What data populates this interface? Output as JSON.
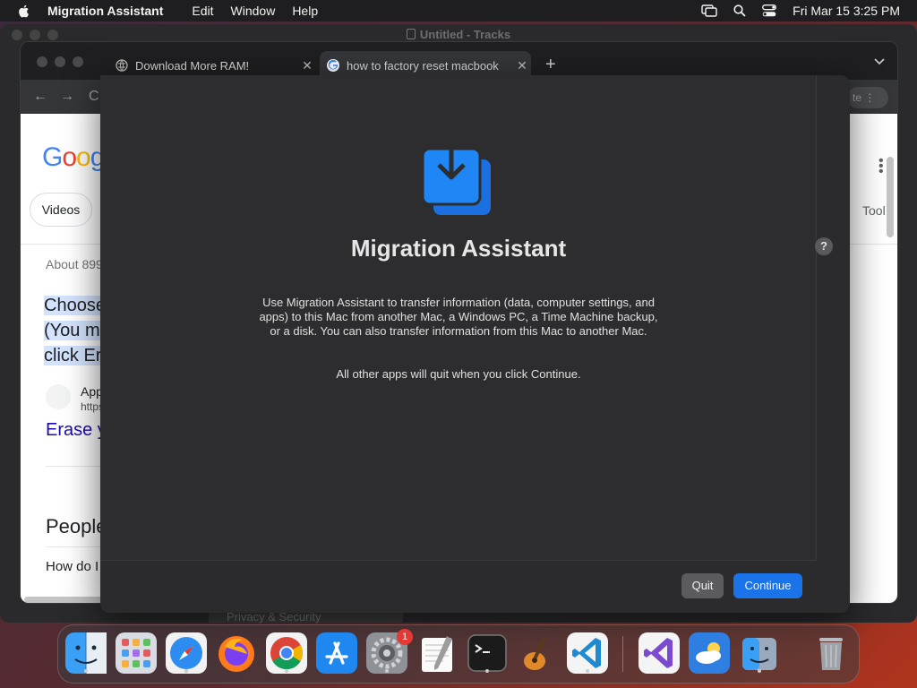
{
  "menubar": {
    "app_name": "Migration Assistant",
    "items": [
      "Edit",
      "Window",
      "Help"
    ],
    "clock": "Fri Mar 15  3:25 PM"
  },
  "background_window": {
    "title": "Untitled - Tracks"
  },
  "browser": {
    "tabs": [
      {
        "label": "Download More RAM!",
        "active": false
      },
      {
        "label": "how to factory reset macbook",
        "active": true
      }
    ],
    "toolbar_right_text": "te",
    "page": {
      "logo": "Goog",
      "chip": "Videos",
      "results_count": "About 899",
      "snippet_lines": [
        "Choose",
        "(You m",
        "click Er"
      ],
      "source_name": "App",
      "source_url": "https",
      "result_link": "Erase y",
      "people_heading": "People",
      "question_1": "How do I",
      "tools": "Tool"
    }
  },
  "dialog": {
    "title": "Migration Assistant",
    "description": "Use Migration Assistant to transfer information (data, computer settings, and apps) to this Mac from another Mac, a Windows PC, a Time Machine backup, or a disk. You can also transfer information from this Mac to another Mac.",
    "note": "All other apps will quit when you click Continue.",
    "help_label": "?",
    "quit_label": "Quit",
    "continue_label": "Continue",
    "accent_color": "#1a73e8"
  },
  "privacy_strip": "Privacy & Security",
  "dock": {
    "items": [
      {
        "name": "finder-icon"
      },
      {
        "name": "launchpad-icon"
      },
      {
        "name": "safari-icon"
      },
      {
        "name": "firefox-icon"
      },
      {
        "name": "chrome-icon"
      },
      {
        "name": "app-store-icon"
      },
      {
        "name": "system-settings-icon",
        "badge": "1"
      },
      {
        "name": "textedit-icon"
      },
      {
        "name": "terminal-icon"
      },
      {
        "name": "garageband-icon"
      },
      {
        "name": "vscode-icon"
      },
      {
        "name": "visual-studio-icon"
      },
      {
        "name": "weather-icon"
      },
      {
        "name": "migration-assistant-dock-icon"
      },
      {
        "name": "trash-icon"
      }
    ]
  }
}
